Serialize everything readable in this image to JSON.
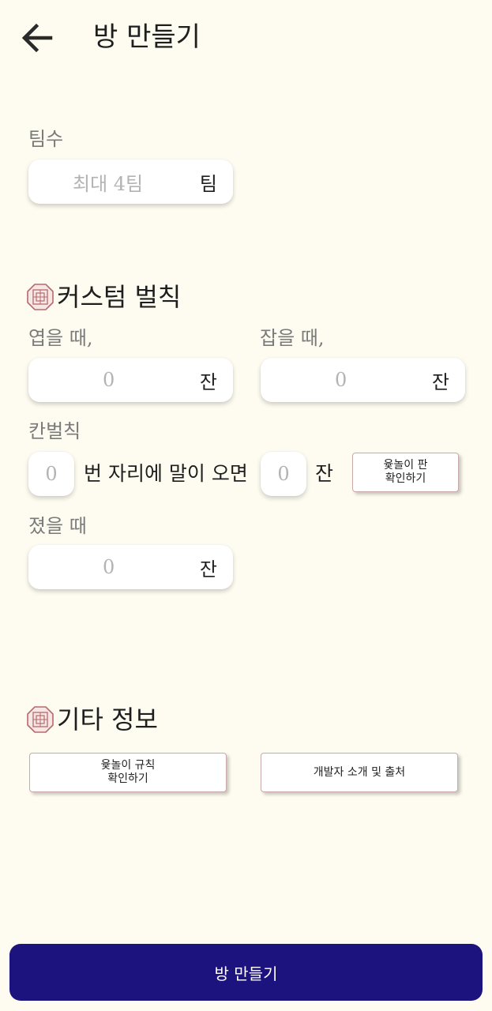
{
  "header": {
    "back_icon": "arrow-left-icon",
    "title": "방 만들기"
  },
  "teams": {
    "label": "팀수",
    "placeholder": "최대 4팀",
    "unit": "팀"
  },
  "custom_rules": {
    "section_title": "커스텀 벌칙",
    "section_icon": "ornament-icon",
    "up": {
      "label": "엽을 때,",
      "placeholder": "0",
      "unit": "잔"
    },
    "catch": {
      "label": "잡을 때,",
      "placeholder": "0",
      "unit": "잔"
    },
    "cell": {
      "label": "칸벌칙",
      "position_placeholder": "0",
      "middle_text": "번 자리에 말이 오면",
      "amount_placeholder": "0",
      "unit": "잔",
      "board_button_line1": "윷놀이 판",
      "board_button_line2": "확인하기"
    },
    "lose": {
      "label": "졌을 때",
      "placeholder": "0",
      "unit": "잔"
    }
  },
  "other_info": {
    "section_title": "기타 정보",
    "section_icon": "ornament-icon",
    "rules_button_line1": "윷놀이 규칙",
    "rules_button_line2": "확인하기",
    "developer_button": "개발자 소개 및 출처"
  },
  "footer": {
    "create_button": "방 만들기",
    "accent_color": "#1D137F"
  }
}
